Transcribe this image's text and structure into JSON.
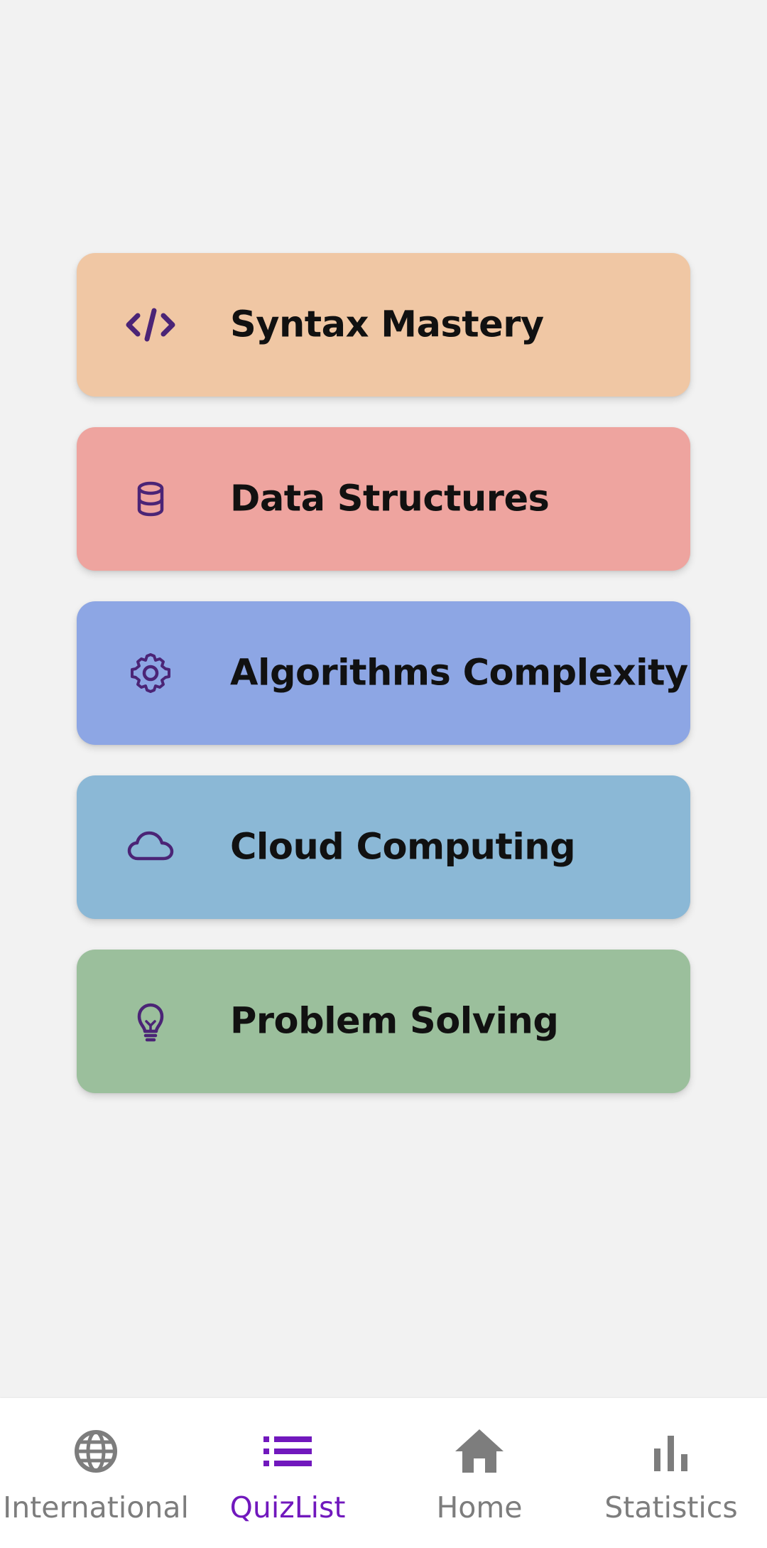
{
  "quizzes": [
    {
      "label": "Syntax Mastery",
      "icon": "code-icon",
      "color": "#f0c7a4"
    },
    {
      "label": "Data Structures",
      "icon": "database-icon",
      "color": "#eea49f"
    },
    {
      "label": "Algorithms Complexity",
      "icon": "gear-icon",
      "color": "#8da6e4"
    },
    {
      "label": "Cloud Computing",
      "icon": "cloud-icon",
      "color": "#8bb8d6"
    },
    {
      "label": "Problem Solving",
      "icon": "lightbulb-icon",
      "color": "#9bbf9c"
    }
  ],
  "nav": {
    "items": [
      {
        "label": "International",
        "icon": "globe-icon"
      },
      {
        "label": "QuizList",
        "icon": "list-icon"
      },
      {
        "label": "Home",
        "icon": "home-icon"
      },
      {
        "label": "Statistics",
        "icon": "bar-chart-icon"
      }
    ],
    "active_index": 1
  },
  "colors": {
    "background": "#f2f2f2",
    "card_icon": "#4b2476",
    "nav_active": "#7118bd",
    "nav_inactive": "#7d7d7d"
  }
}
